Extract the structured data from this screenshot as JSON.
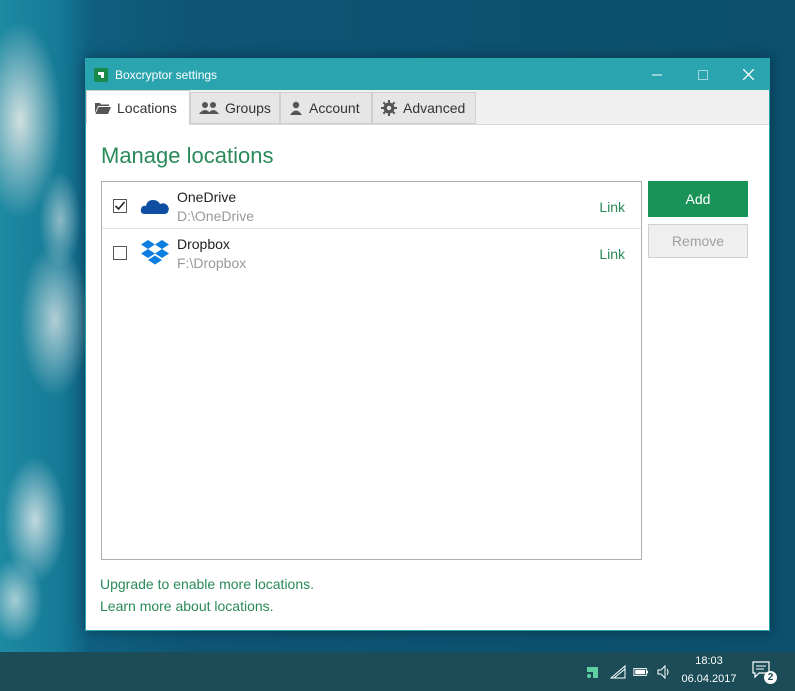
{
  "window": {
    "title": "Boxcryptor settings",
    "minimize_glyph": "—",
    "maximize_glyph": "☐",
    "close_glyph": "✕"
  },
  "tabs": [
    {
      "label": "Locations",
      "icon": "folder-icon",
      "active": true
    },
    {
      "label": "Groups",
      "icon": "users-icon",
      "active": false
    },
    {
      "label": "Account",
      "icon": "user-icon",
      "active": false
    },
    {
      "label": "Advanced",
      "icon": "gear-icon",
      "active": false
    }
  ],
  "main": {
    "heading": "Manage locations",
    "locations": [
      {
        "name": "OneDrive",
        "path": "D:\\OneDrive",
        "checked": true,
        "link": "Link",
        "icon": "onedrive-icon"
      },
      {
        "name": "Dropbox",
        "path": "F:\\Dropbox",
        "checked": false,
        "link": "Link",
        "icon": "dropbox-icon"
      }
    ],
    "add_label": "Add",
    "remove_label": "Remove",
    "upgrade_link": "Upgrade to enable more locations.",
    "learn_link": "Learn more about locations."
  },
  "taskbar": {
    "time": "18:03",
    "date": "06.04.2017",
    "notification_count": "2"
  },
  "colors": {
    "titlebar": "#2aa5b0",
    "accent_green": "#1a9358",
    "link_green": "#2a8a5a",
    "taskbar": "#1b4c58"
  }
}
